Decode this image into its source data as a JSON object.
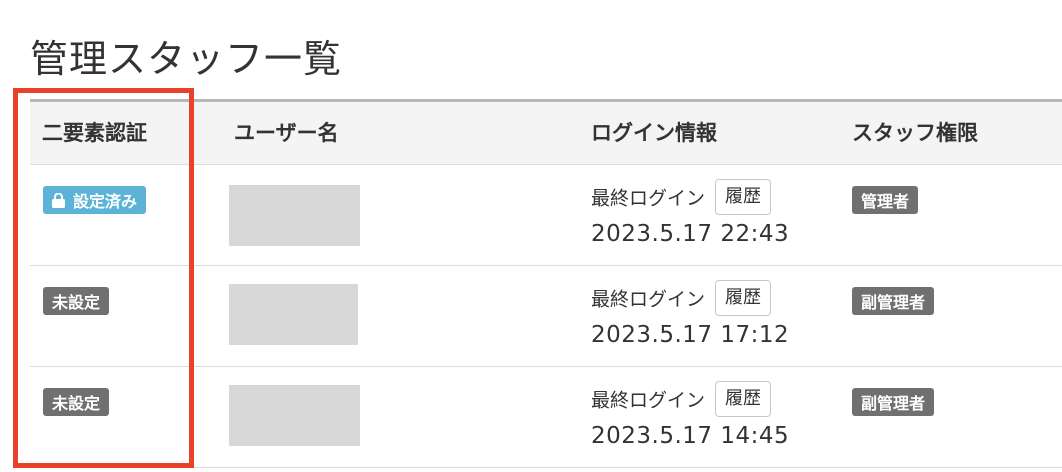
{
  "page": {
    "title": "管理スタッフ一覧"
  },
  "table": {
    "headers": {
      "two_factor": "二要素認証",
      "username": "ユーザー名",
      "login_info": "ログイン情報",
      "permission": "スタッフ権限"
    },
    "rows": [
      {
        "two_factor": {
          "label": "設定済み",
          "status": "set",
          "icon": "lock-icon"
        },
        "login_label": "最終ログイン",
        "history_label": "履歴",
        "login_date": "2023.5.17 22:43",
        "role": "管理者"
      },
      {
        "two_factor": {
          "label": "未設定",
          "status": "unset"
        },
        "login_label": "最終ログイン",
        "history_label": "履歴",
        "login_date": "2023.5.17 17:12",
        "role": "副管理者"
      },
      {
        "two_factor": {
          "label": "未設定",
          "status": "unset"
        },
        "login_label": "最終ログイン",
        "history_label": "履歴",
        "login_date": "2023.5.17 14:45",
        "role": "副管理者"
      }
    ]
  },
  "colors": {
    "badge_set": "#5bb4d8",
    "badge_unset": "#707070",
    "highlight": "#e8432a",
    "avatar_placeholder": "#d8d8d8"
  }
}
